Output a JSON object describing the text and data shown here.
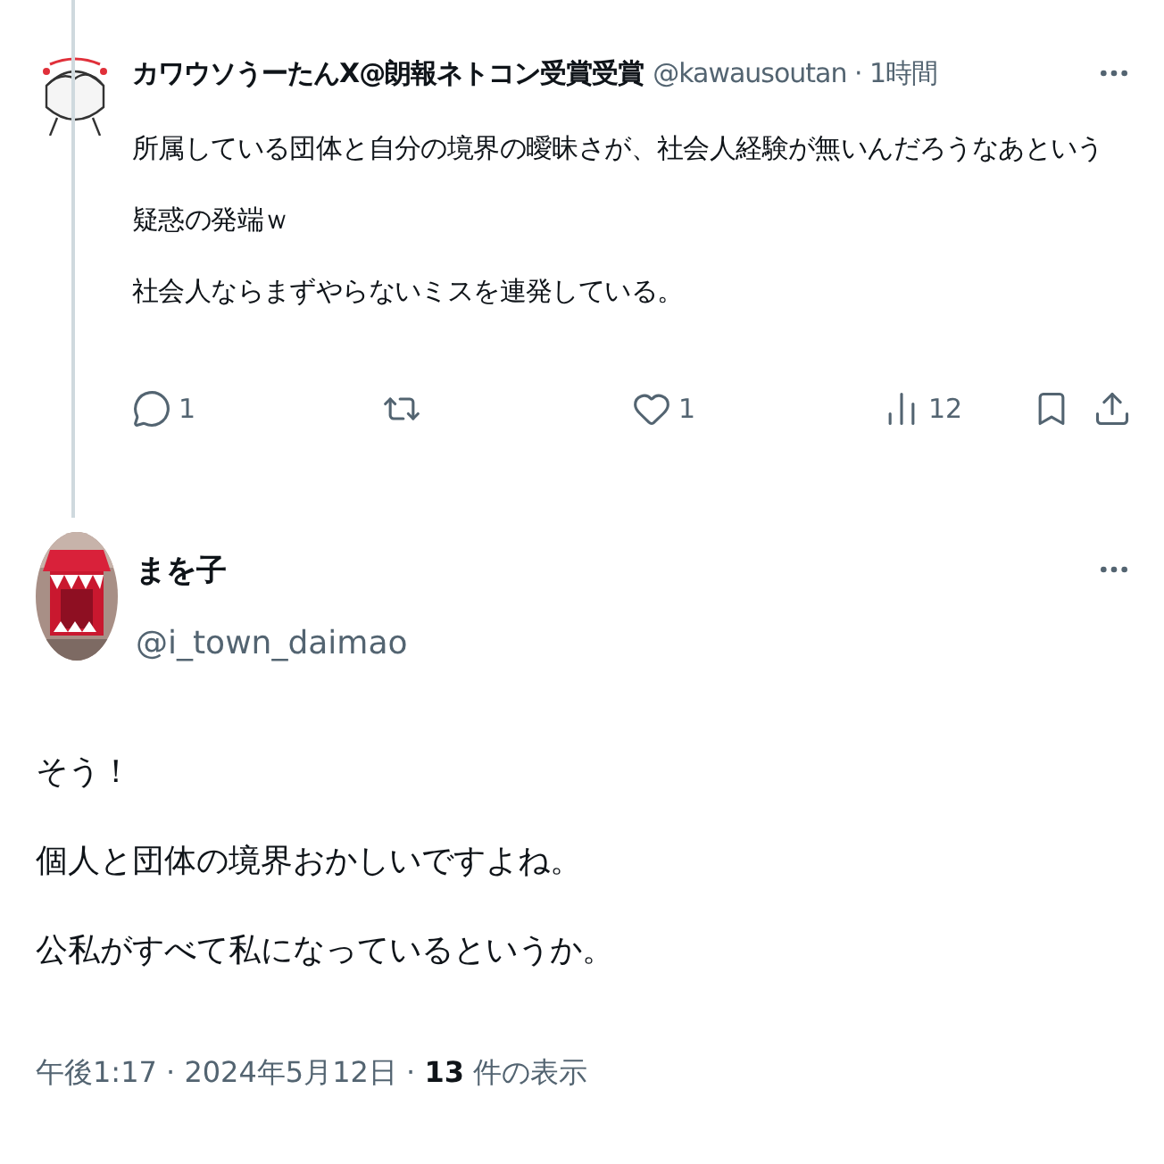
{
  "thread_post": {
    "author_name": "カワウソうーたんX@朗報ネトコン受賞受賞",
    "meta": "@kawausoutan · 1時間",
    "lines": [
      "所属している団体と自分の境界の曖昧さが、社会人経験が無いんだろうなあという",
      "疑惑の発端ｗ",
      "社会人ならまずやらないミスを連発している。"
    ],
    "actions": [
      {
        "kind": "reply",
        "count": "1"
      },
      {
        "kind": "repost"
      },
      {
        "kind": "like",
        "count": "1"
      },
      {
        "kind": "views",
        "count": "12"
      },
      {
        "kind": "bookmark"
      },
      {
        "kind": "share"
      }
    ]
  },
  "reply_post": {
    "author_name": "まを子",
    "handle": "@i_town_daimao",
    "lines": [
      "そう！",
      "個人と団体の境界おかしいですよね。",
      "公私がすべて私になっているというか。"
    ],
    "footer": "午後1:17 · 2024年5月12日 · **13** 件の表示"
  }
}
